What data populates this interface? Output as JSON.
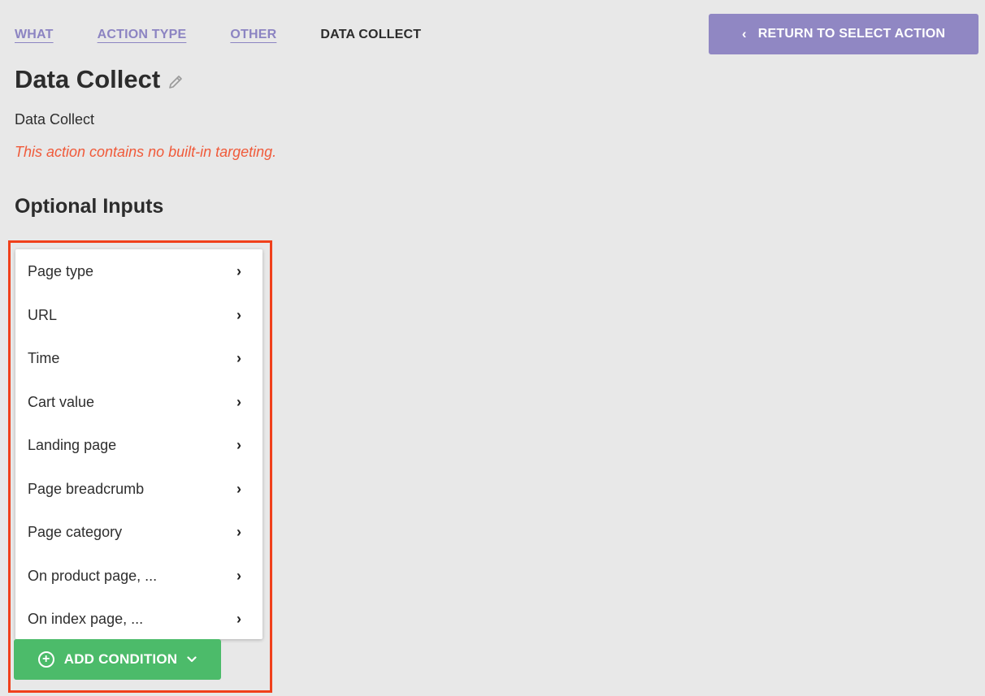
{
  "breadcrumb": {
    "items": [
      {
        "label": "WHAT",
        "link": true
      },
      {
        "label": "ACTION TYPE",
        "link": true
      },
      {
        "label": "OTHER",
        "link": true
      },
      {
        "label": "DATA COLLECT",
        "link": false
      }
    ]
  },
  "return_button": {
    "icon": "chevron-left-icon",
    "label": "RETURN TO SELECT ACTION"
  },
  "page": {
    "title": "Data Collect",
    "edit_icon": "pencil-icon",
    "subtitle": "Data Collect",
    "warning": "This action contains no built-in targeting.",
    "section_heading": "Optional Inputs"
  },
  "condition_menu": {
    "items": [
      {
        "label": "Page type"
      },
      {
        "label": "URL"
      },
      {
        "label": "Time"
      },
      {
        "label": "Cart value"
      },
      {
        "label": "Landing page"
      },
      {
        "label": "Page breadcrumb"
      },
      {
        "label": "Page category"
      },
      {
        "label": "On product page, ..."
      },
      {
        "label": "On index page, ..."
      }
    ],
    "item_arrow": "›"
  },
  "add_condition_button": {
    "label": "ADD CONDITION",
    "icon": "plus-circle-icon",
    "dropdown_icon": "chevron-down-icon"
  },
  "colors": {
    "accent_purple": "#9087c3",
    "link_purple": "#8c84c2",
    "warning_red": "#f05a3a",
    "success_green": "#4cbb6a",
    "highlight_red": "#f0401b",
    "background": "#e8e8e8"
  }
}
